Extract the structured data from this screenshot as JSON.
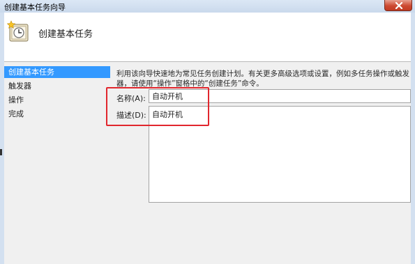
{
  "window": {
    "title": "创建基本任务向导"
  },
  "header": {
    "title": "创建基本任务",
    "icon": "task-scheduler-clock-icon"
  },
  "nav": {
    "items": [
      {
        "label": "创建基本任务",
        "active": true
      },
      {
        "label": "触发器",
        "active": false
      },
      {
        "label": "操作",
        "active": false
      },
      {
        "label": "完成",
        "active": false
      }
    ]
  },
  "main": {
    "intro_line1": "利用该向导快速地为常见任务创建计划。有关更多高级选项或设置，例如多任务操作或触发",
    "intro_line2": "器，请使用“操作”窗格中的“创建任务”命令。",
    "name_label": "名称(A):",
    "name_value": "自动开机",
    "desc_label": "描述(D):",
    "desc_value": "自动开机"
  },
  "colors": {
    "highlight_box": "#e1262d",
    "nav_selected": "#3399ff",
    "close_button": "#cd4a32"
  }
}
